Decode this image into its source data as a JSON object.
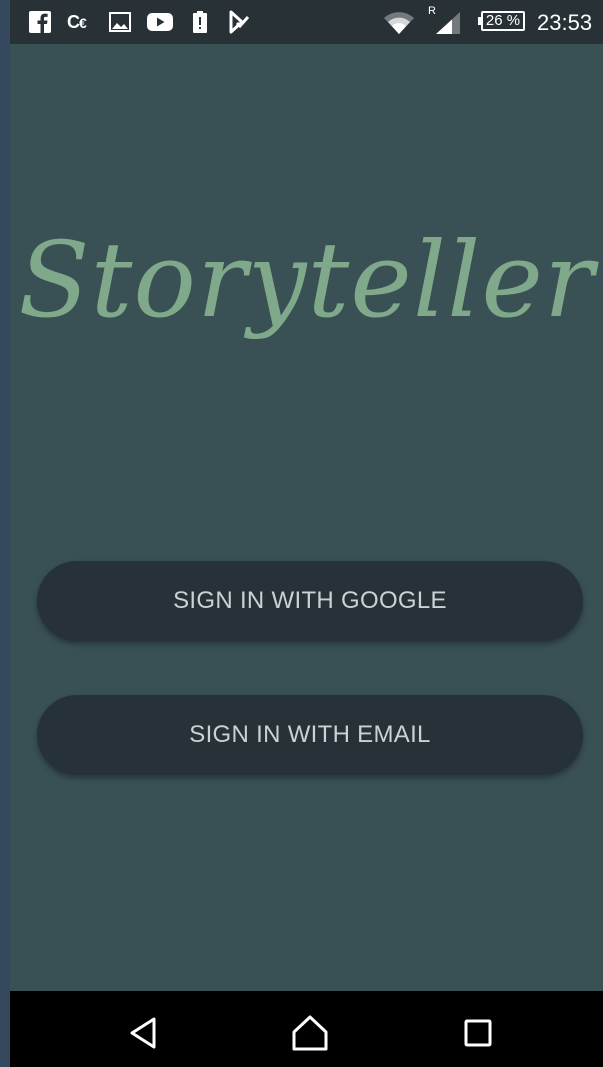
{
  "status_bar": {
    "notification_icons": [
      "facebook-icon",
      "cc-icon",
      "image-icon",
      "youtube-icon",
      "alert-icon",
      "task-icon"
    ],
    "roaming_label": "R",
    "battery_label": "26 %",
    "time": "23:53"
  },
  "app": {
    "title": "Storyteller",
    "title_color": "#7fa98a",
    "background_color": "#395154"
  },
  "buttons": {
    "google_label": "SIGN IN WITH GOOGLE",
    "email_label": "SIGN IN WITH EMAIL",
    "button_color": "#263238"
  },
  "nav_bar": {
    "icons": [
      "back-icon",
      "home-icon",
      "recents-icon"
    ]
  }
}
